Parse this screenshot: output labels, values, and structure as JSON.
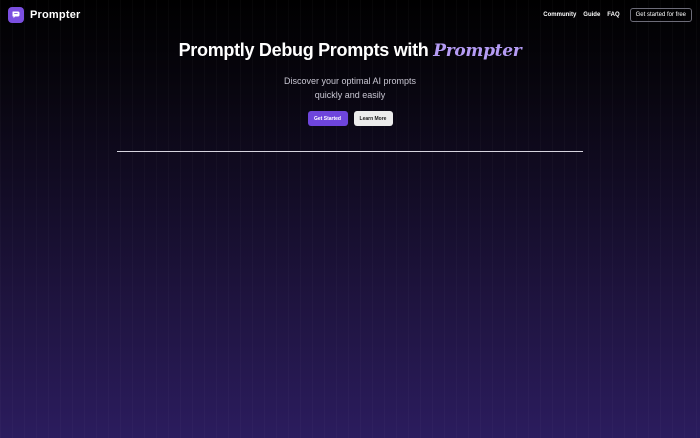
{
  "brand": {
    "name": "Prompter",
    "logo_icon": "chat-bubble-icon",
    "logo_color": "#7b4fe0"
  },
  "nav": {
    "links": [
      "Community",
      "Guide",
      "FAQ"
    ],
    "cta_label": "Get started for free"
  },
  "hero": {
    "title_main": "Promptly Debug Prompts with ",
    "title_accent": "Prompter",
    "subtitle_line1": "Discover your optimal AI prompts",
    "subtitle_line2": "quickly and easily",
    "primary_button": "Get Started",
    "secondary_button": "Learn More"
  },
  "colors": {
    "accent": "#6e45dc",
    "accent_text": "#b59cf5",
    "background_top": "#000000",
    "background_bottom": "#2b1c5e"
  }
}
